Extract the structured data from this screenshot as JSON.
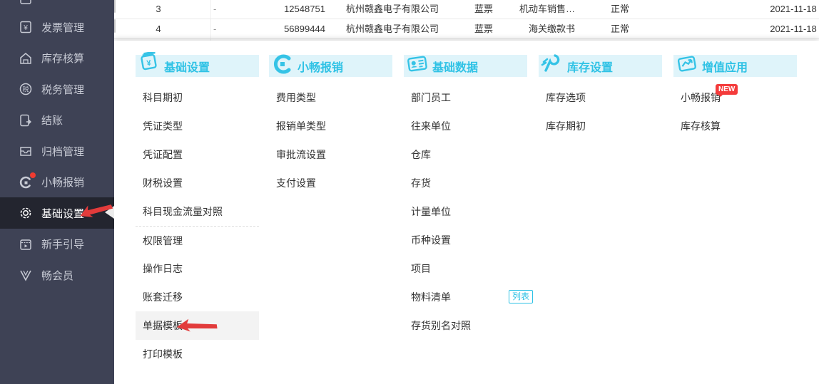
{
  "sidebar": {
    "items": [
      {
        "label": "发票管理",
        "icon": "invoice-icon"
      },
      {
        "label": "库存核算",
        "icon": "warehouse-icon"
      },
      {
        "label": "税务管理",
        "icon": "tax-icon"
      },
      {
        "label": "结账",
        "icon": "closing-icon"
      },
      {
        "label": "归档管理",
        "icon": "archive-icon"
      },
      {
        "label": "小畅报销",
        "icon": "reimburse-icon",
        "has_red_dot": true
      },
      {
        "label": "基础设置",
        "icon": "gear-icon",
        "active": true
      },
      {
        "label": "新手引导",
        "icon": "guide-icon"
      },
      {
        "label": "畅会员",
        "icon": "member-icon"
      }
    ]
  },
  "table": {
    "rows": [
      {
        "index": "3",
        "dash": "-",
        "invoice_no": "12548751",
        "company": "杭州赣鑫电子有限公司",
        "ticket_type": "蓝票",
        "category": "机动车销售…",
        "status": "正常",
        "date": "2021-11-18"
      },
      {
        "index": "4",
        "dash": "-",
        "invoice_no": "56899444",
        "company": "杭州赣鑫电子有限公司",
        "ticket_type": "蓝票",
        "category": "海关缴款书",
        "status": "正常",
        "date": "2021-11-18"
      }
    ]
  },
  "menu": {
    "columns": [
      {
        "title": "基础设置",
        "icon": "ledger-stack-icon",
        "items": [
          "科目期初",
          "凭证类型",
          "凭证配置",
          "财税设置",
          "科目现金流量对照",
          "权限管理",
          "操作日志",
          "账套迁移",
          "单据模板",
          "打印模板"
        ]
      },
      {
        "title": "小畅报销",
        "icon": "c-logo-icon",
        "items": [
          "费用类型",
          "报销单类型",
          "审批流设置",
          "支付设置"
        ]
      },
      {
        "title": "基础数据",
        "icon": "id-card-icon",
        "items": [
          "部门员工",
          "往来单位",
          "仓库",
          "存货",
          "计量单位",
          "币种设置",
          "项目",
          "物料清单",
          "存货别名对照"
        ]
      },
      {
        "title": "库存设置",
        "icon": "wrench-icon",
        "items": [
          "库存选项",
          "库存期初"
        ]
      },
      {
        "title": "增值应用",
        "icon": "value-apps-icon",
        "items": [
          "小畅报销",
          "库存核算"
        ]
      }
    ],
    "list_badge": "列表",
    "new_badge": "NEW"
  },
  "colors": {
    "accent_cyan": "#2fc2e5",
    "header_bg": "#dff4fa",
    "sidebar_bg": "#3e4255",
    "sidebar_active_bg": "#23252f",
    "annotation_red": "#e23b3b",
    "badge_red": "#f43b3b",
    "notification_red": "#f03b30"
  }
}
